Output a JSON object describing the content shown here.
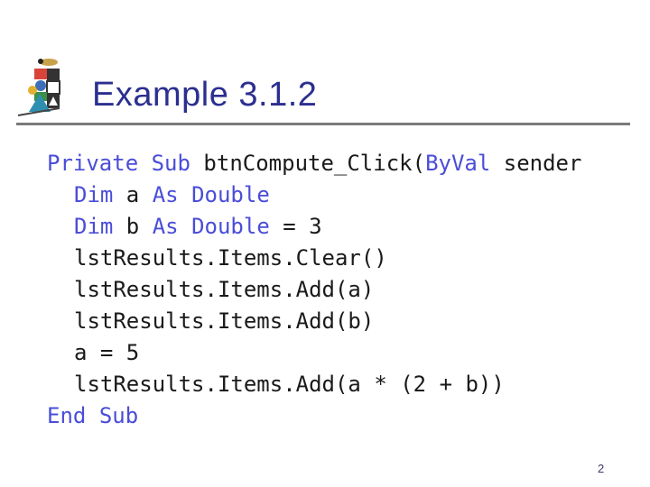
{
  "slide": {
    "title": "Example 3.1.2",
    "page_number": "2"
  },
  "code": {
    "line1": {
      "kw1": "Private",
      "sp1": " ",
      "kw2": "Sub",
      "rest1": " btnCompute_Click(",
      "kw3": "ByVal",
      "rest2": " sender"
    },
    "line2": {
      "kw1": "Dim",
      "rest1": " a ",
      "kw2": "As",
      "sp": " ",
      "kw3": "Double"
    },
    "line3": {
      "kw1": "Dim",
      "rest1": " b ",
      "kw2": "As",
      "sp": " ",
      "kw3": "Double",
      "rest2": " = 3"
    },
    "line4": "lstResults.Items.Clear()",
    "line5": "lstResults.Items.Add(a)",
    "line6": "lstResults.Items.Add(b)",
    "line7": "a = 5",
    "line8": "lstResults.Items.Add(a * (2 + b))",
    "line9": {
      "kw1": "End",
      "sp": " ",
      "kw2": "Sub"
    }
  },
  "colors": {
    "title": "#2b2f8f",
    "keyword": "#4a4dd8",
    "code_text": "#1a1a1a",
    "rule": "#7a7a7a"
  },
  "icons": {
    "logo": "shapes-logo-icon"
  }
}
